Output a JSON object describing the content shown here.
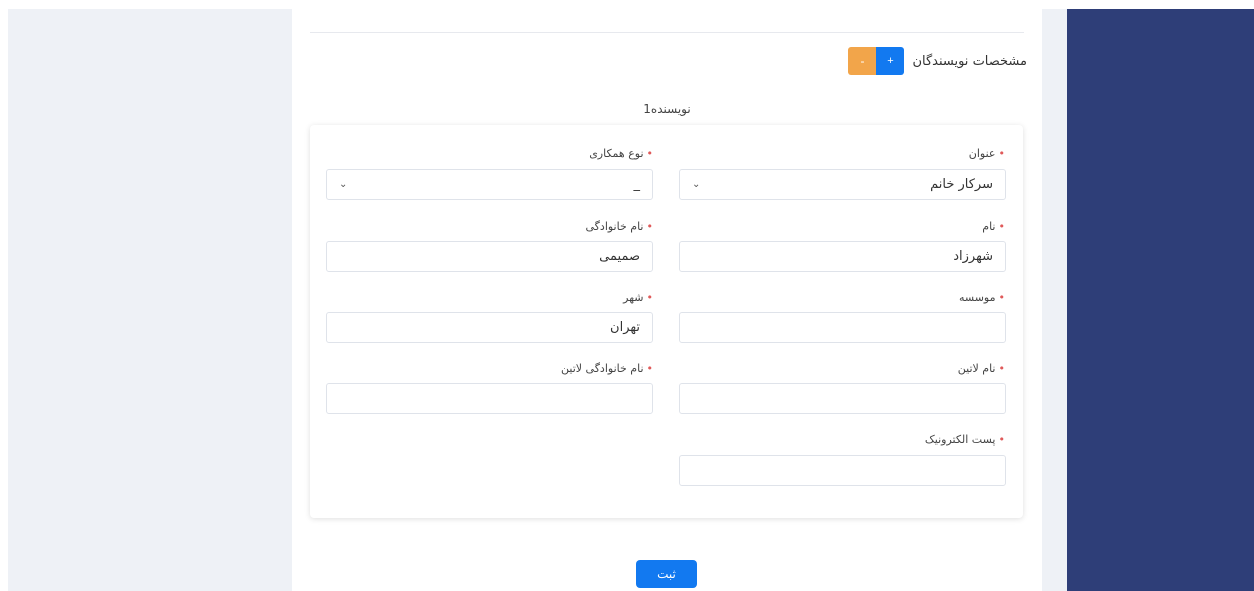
{
  "section": {
    "title": "مشخصات نویسندگان",
    "add_label": "+",
    "remove_label": "-"
  },
  "author": {
    "heading": "نویسنده1",
    "fields": {
      "title": {
        "label": "عنوان",
        "value": "سرکار خانم"
      },
      "cooperation_type": {
        "label": "نوع همکاری",
        "value": "_"
      },
      "first_name": {
        "label": "نام",
        "value": "شهرزاد"
      },
      "last_name": {
        "label": "نام خانوادگی",
        "value": "صمیمی"
      },
      "institution": {
        "label": "موسسه",
        "value": ""
      },
      "city": {
        "label": "شهر",
        "value": "تهران"
      },
      "latin_first_name": {
        "label": "نام لاتین",
        "value": ""
      },
      "latin_last_name": {
        "label": "نام خانوادگی لاتین",
        "value": ""
      },
      "email": {
        "label": "پست الکترونیک",
        "value": ""
      }
    },
    "required_mark": "•",
    "chevron": "⌄"
  },
  "submit_label": "ثبت",
  "colors": {
    "sidebar": "#2e3e78",
    "primary": "#1279f0",
    "warning": "#f2a54a",
    "required": "#e05a5a"
  }
}
